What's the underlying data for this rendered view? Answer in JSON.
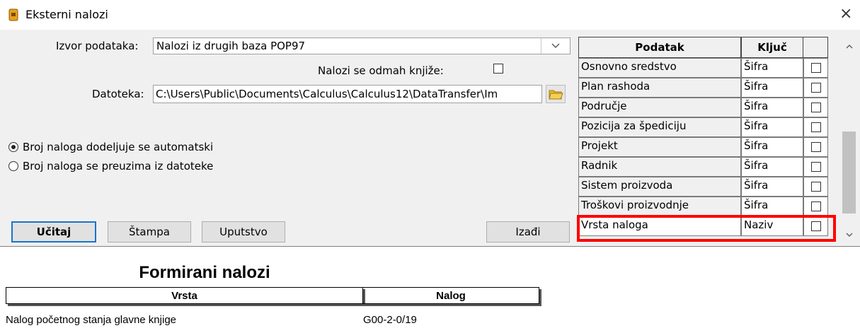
{
  "window": {
    "title": "Eksterni nalozi",
    "close_glyph": "×"
  },
  "form": {
    "source_label": "Izvor podataka:",
    "source_value": "Nalozi iz drugih baza POP97",
    "post_label": "Nalozi se odmah knjiže:",
    "file_label": "Datoteka:",
    "file_value": "C:\\Users\\Public\\Documents\\Calculus\\Calculus12\\DataTransfer\\Im",
    "radio_auto": "Broj naloga dodeljuje se automatski",
    "radio_file": "Broj naloga se preuzima iz datoteke",
    "buttons": {
      "load": "Učitaj",
      "print": "Štampa",
      "help": "Uputstvo",
      "exit": "Izađi"
    }
  },
  "grid": {
    "headers": {
      "name": "Podatak",
      "key": "Ključ"
    },
    "rows": [
      {
        "name": "Osnovno sredstvo",
        "key": "Šifra",
        "checked": false
      },
      {
        "name": "Plan rashoda",
        "key": "Šifra",
        "checked": false
      },
      {
        "name": "Područje",
        "key": "Šifra",
        "checked": false
      },
      {
        "name": "Pozicija za špediciju",
        "key": "Šifra",
        "checked": false
      },
      {
        "name": "Projekt",
        "key": "Šifra",
        "checked": false
      },
      {
        "name": "Radnik",
        "key": "Šifra",
        "checked": false
      },
      {
        "name": "Sistem proizvoda",
        "key": "Šifra",
        "checked": false
      },
      {
        "name": "Troškovi proizvodnje",
        "key": "Šifra",
        "checked": false
      },
      {
        "name": "Vrsta naloga",
        "key": "Naziv",
        "checked": false
      }
    ],
    "highlight_color": "#ff0000"
  },
  "report": {
    "title": "Formirani nalozi",
    "columns": {
      "type": "Vrsta",
      "order": "Nalog"
    },
    "rows": [
      {
        "type": "Nalog početnog stanja glavne knjige",
        "order": "G00-2-0/19"
      }
    ]
  },
  "icons": {
    "app": "app-icon",
    "folder": "folder-icon",
    "dropdown": "chevron-down-icon"
  },
  "accent": "#1874cd"
}
